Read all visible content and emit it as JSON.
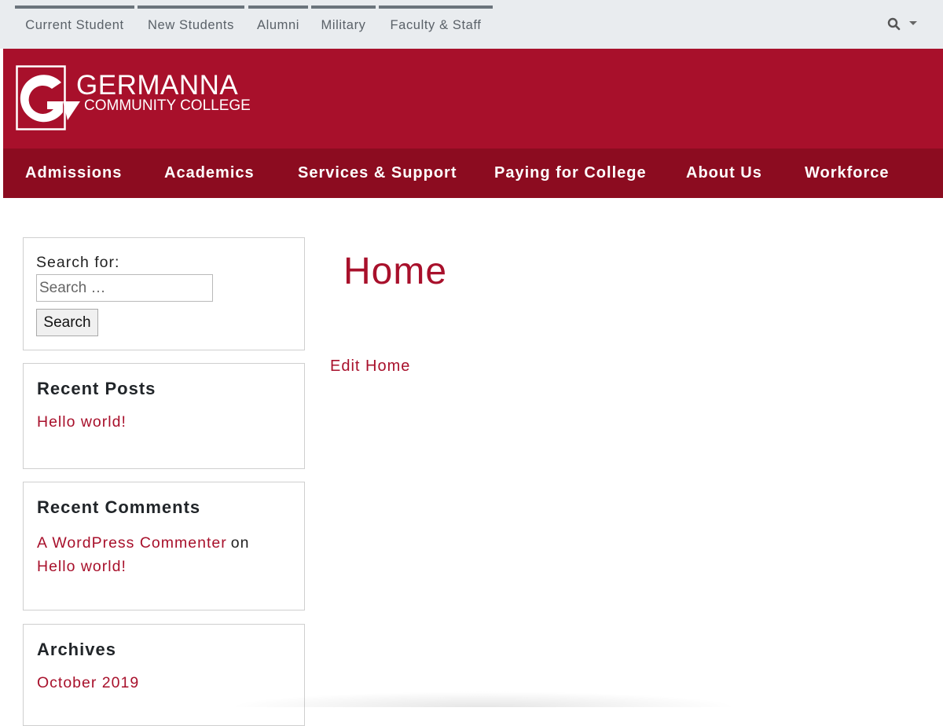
{
  "audience_nav": {
    "items": [
      {
        "label": "Current Student"
      },
      {
        "label": "New Students"
      },
      {
        "label": "Alumni"
      },
      {
        "label": "Military"
      },
      {
        "label": "Faculty & Staff"
      }
    ],
    "search_icon": "search-icon"
  },
  "brand": {
    "logo_letter": "G",
    "name_line1": "GERMANNA",
    "name_line2": "COMMUNITY COLLEGE",
    "color": "#a8102b"
  },
  "main_nav": {
    "items": [
      {
        "label": "Admissions"
      },
      {
        "label": "Academics"
      },
      {
        "label": "Services & Support"
      },
      {
        "label": "Paying for College"
      },
      {
        "label": "About Us"
      },
      {
        "label": "Workforce"
      }
    ],
    "color": "#8c0c20"
  },
  "sidebar": {
    "search": {
      "label": "Search for:",
      "placeholder": "Search …",
      "value": "",
      "button": "Search"
    },
    "recent_posts": {
      "title": "Recent Posts",
      "items": [
        {
          "label": "Hello world!"
        }
      ]
    },
    "recent_comments": {
      "title": "Recent Comments",
      "author": "A WordPress Commenter",
      "on_text": "on",
      "post": "Hello world!"
    },
    "archives": {
      "title": "Archives",
      "items": [
        {
          "label": "October 2019"
        }
      ]
    }
  },
  "content": {
    "title": "Home",
    "edit_link": "Edit Home"
  },
  "colors": {
    "accent": "#a8102b",
    "topbar_bg": "#e9ecef"
  }
}
